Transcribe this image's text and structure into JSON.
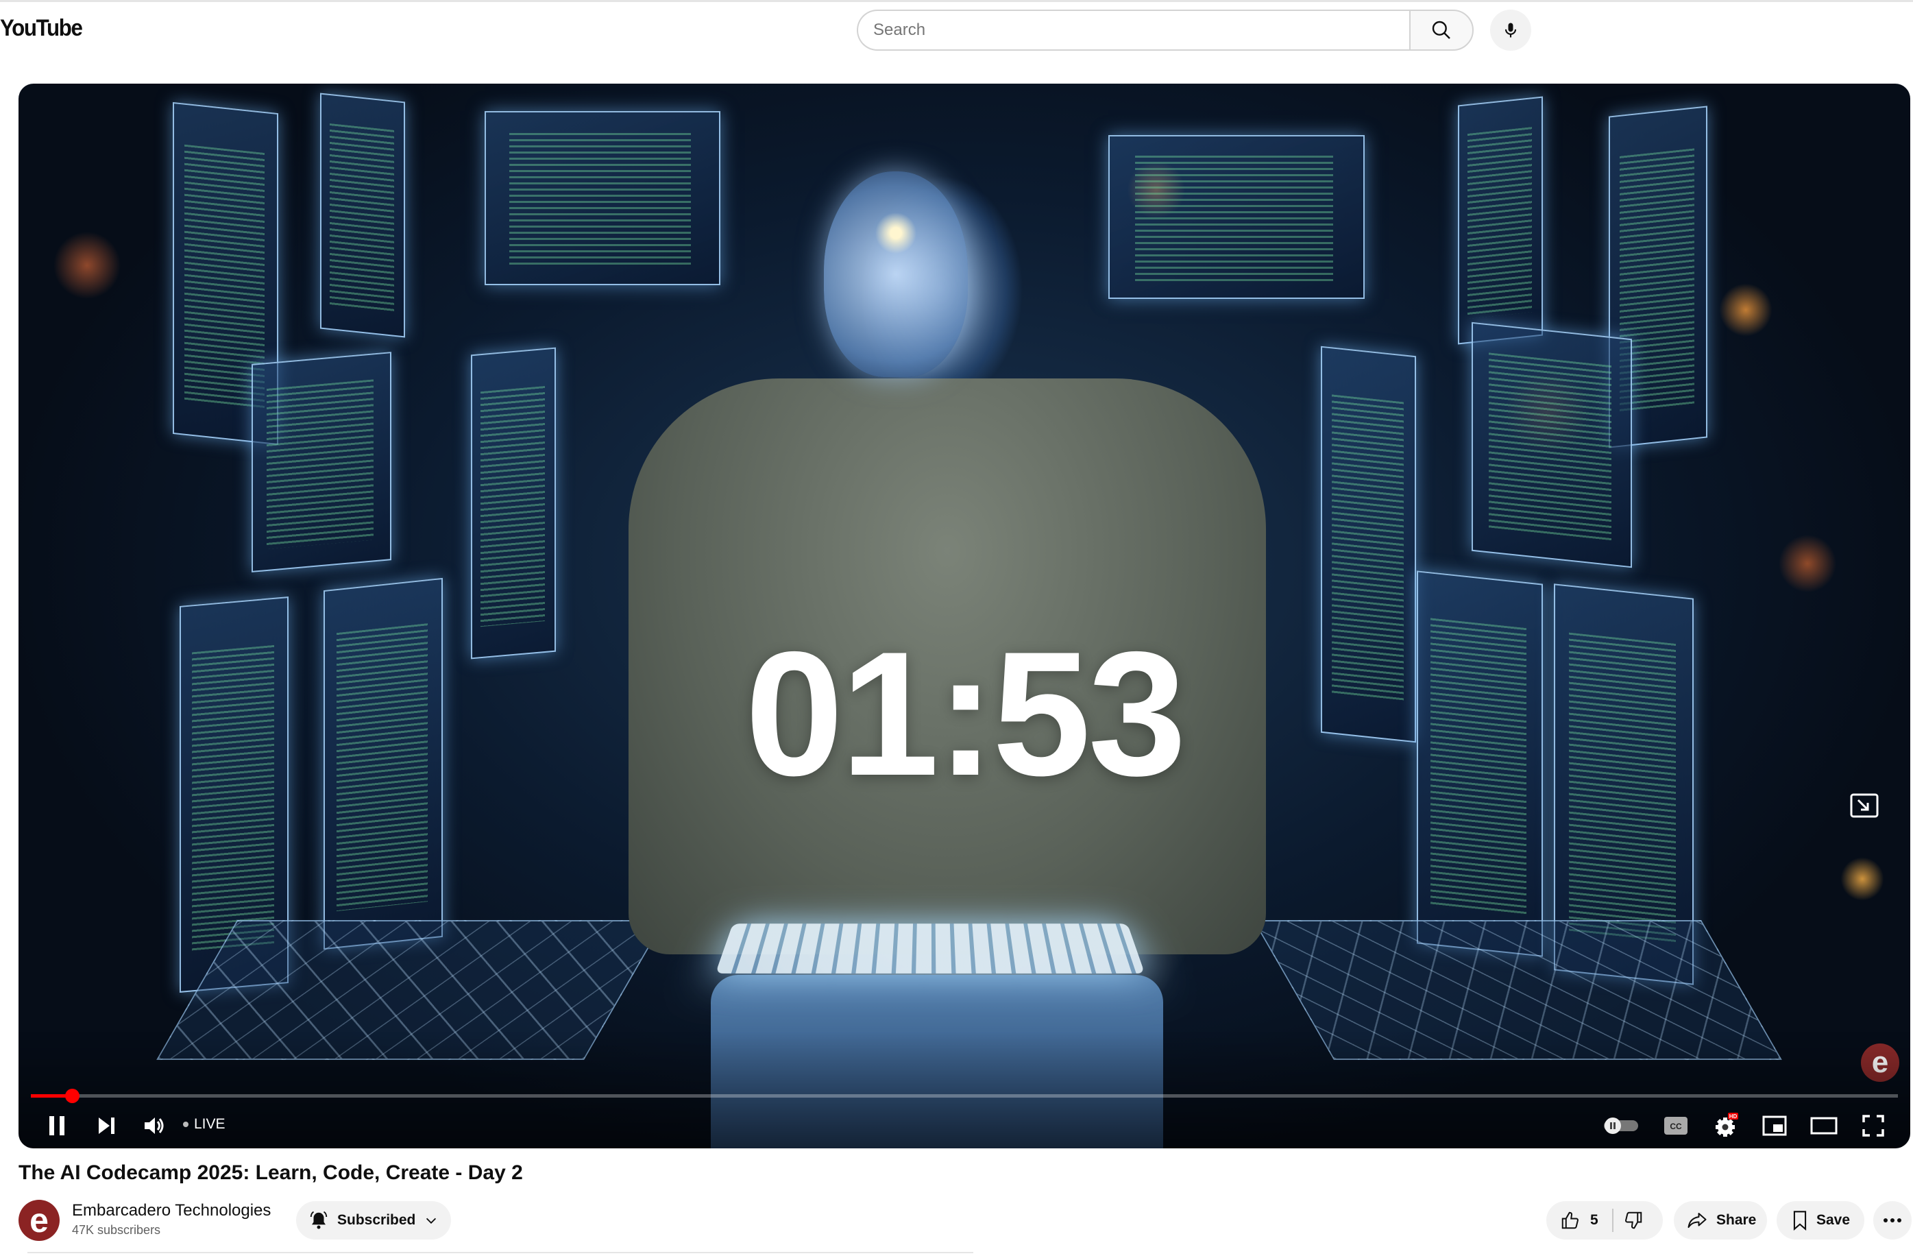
{
  "header": {
    "logo_text": "YouTube",
    "search_placeholder": "Search"
  },
  "player": {
    "overlay_text": "01:53",
    "progress_fraction": 0.022,
    "live_label": "LIVE",
    "watermark_letter": "e",
    "progress_color": "#ff0000",
    "hd_badge": "HD"
  },
  "video": {
    "title": "The AI Codecamp 2025: Learn, Code, Create - Day 2"
  },
  "channel": {
    "avatar_letter": "e",
    "name": "Embarcadero Technologies",
    "subscribers": "47K subscribers",
    "subscribe_label": "Subscribed"
  },
  "actions": {
    "like_count": "5",
    "share_label": "Share",
    "save_label": "Save"
  }
}
